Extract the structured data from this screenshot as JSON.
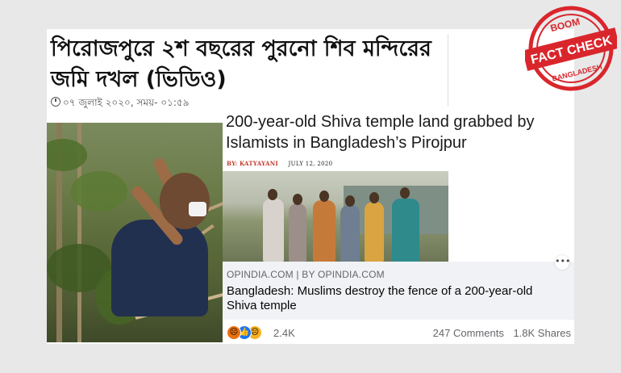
{
  "bengali_article": {
    "title": "পিরোজপুরে ২শ বছরের পুরনো শিব মন্দিরের জমি দখল (ভিডিও)",
    "meta": "০৭ জুলাই ২০২০, সময়- ০১:৫৯"
  },
  "opindia_article": {
    "title": "200-year-old Shiva temple land grabbed by Islamists in Bangladesh’s Pirojpur",
    "byline_prefix": "BY:",
    "author": "KATYAYANI",
    "date": "JULY 12, 2020"
  },
  "facebook_post": {
    "site": "OPINDIA.COM | BY OPINDIA.COM",
    "headline": "Bangladesh: Muslims destroy the fence of a 200-year-old Shiva temple",
    "more_icon": "more-icon",
    "reactions": [
      "angry",
      "like",
      "sad"
    ],
    "reaction_count": "2.4K",
    "comments": "247 Comments",
    "shares": "1.8K Shares"
  },
  "stamp": {
    "top": "BOOM",
    "middle": "FACT CHECK",
    "bottom": "BANGLADESH",
    "color": "#d9262c"
  }
}
